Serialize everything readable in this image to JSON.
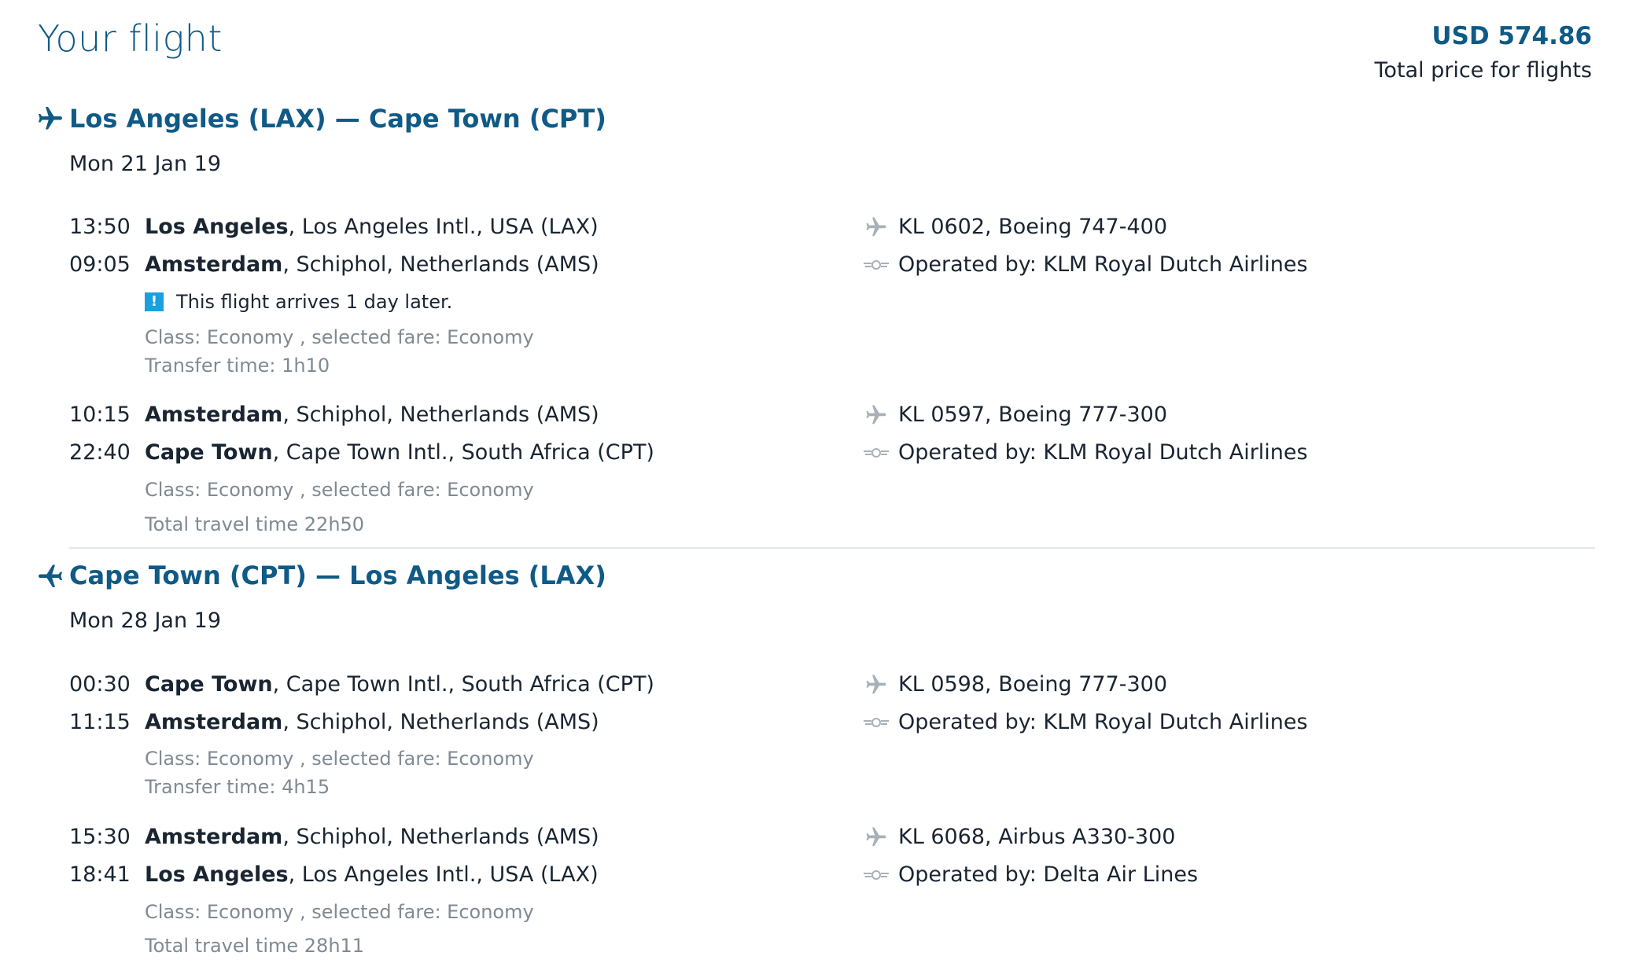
{
  "header": {
    "title": "Your flight",
    "price": "USD 574.86",
    "price_label": "Total price for flights"
  },
  "colors": {
    "brand": "#0f5a86",
    "info": "#1a9fe0",
    "muted": "#7f8a93"
  },
  "journeys": [
    {
      "route": "Los Angeles (LAX) — Cape Town (CPT)",
      "date": "Mon 21 Jan 19",
      "segments": [
        {
          "dep_time": "13:50",
          "dep_city": "Los Angeles",
          "dep_rest": ", Los Angeles Intl., USA (LAX)",
          "arr_time": "09:05",
          "arr_city": "Amsterdam",
          "arr_rest": ", Schiphol, Netherlands (AMS)",
          "flight": "KL 0602, Boeing 747-400",
          "operated": "Operated by: KLM Royal Dutch Airlines",
          "notice": "This flight arrives 1 day later.",
          "class": "Class: Economy , selected fare: Economy",
          "extra": "Transfer time: 1h10"
        },
        {
          "dep_time": "10:15",
          "dep_city": "Amsterdam",
          "dep_rest": ", Schiphol, Netherlands (AMS)",
          "arr_time": "22:40",
          "arr_city": "Cape Town",
          "arr_rest": ", Cape Town Intl., South Africa (CPT)",
          "flight": "KL 0597, Boeing 777-300",
          "operated": "Operated by: KLM Royal Dutch Airlines",
          "class": "Class: Economy , selected fare: Economy",
          "extra": "Total travel time 22h50"
        }
      ]
    },
    {
      "route": "Cape Town (CPT) — Los Angeles (LAX)",
      "date": "Mon 28 Jan 19",
      "segments": [
        {
          "dep_time": "00:30",
          "dep_city": "Cape Town",
          "dep_rest": ", Cape Town Intl., South Africa (CPT)",
          "arr_time": "11:15",
          "arr_city": "Amsterdam",
          "arr_rest": ", Schiphol, Netherlands (AMS)",
          "flight": "KL 0598, Boeing 777-300",
          "operated": "Operated by: KLM Royal Dutch Airlines",
          "class": "Class: Economy , selected fare: Economy",
          "extra": "Transfer time: 4h15"
        },
        {
          "dep_time": "15:30",
          "dep_city": "Amsterdam",
          "dep_rest": ", Schiphol, Netherlands (AMS)",
          "arr_time": "18:41",
          "arr_city": "Los Angeles",
          "arr_rest": ", Los Angeles Intl., USA (LAX)",
          "flight": "KL 6068, Airbus A330-300",
          "operated": "Operated by: Delta Air Lines",
          "class": "Class: Economy , selected fare: Economy",
          "extra": "Total travel time 28h11"
        }
      ]
    }
  ]
}
